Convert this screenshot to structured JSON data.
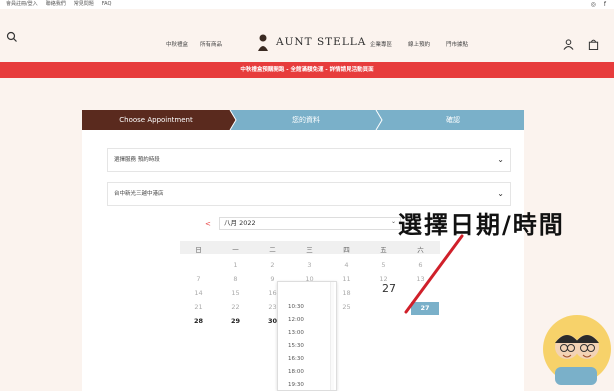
{
  "topbar": {
    "links": [
      "會員註冊/登入",
      "聯絡我們",
      "常見問題",
      "FAQ"
    ],
    "social_icons": [
      "instagram-icon",
      "facebook-icon"
    ]
  },
  "header": {
    "logo_text": "AUNT STELLA",
    "nav_left": [
      "中秋禮盒",
      "所有商品"
    ],
    "nav_right": [
      "企業專區",
      "線上預約",
      "門市據點"
    ],
    "icons": [
      "search-icon",
      "user-icon",
      "bag-icon"
    ]
  },
  "promo": {
    "text": "中秋禮盒預購開跑 - 全館滿額免運 - 詳情請見活動頁面"
  },
  "steps": {
    "items": [
      "Choose Appointment",
      "您的資料",
      "確認"
    ],
    "active_index": 0,
    "colors": {
      "active": "#5a2a1e",
      "inactive": "#7ab0c9",
      "text_inactive": "#ffffff"
    }
  },
  "accordion": [
    {
      "label": "選擇服務 預約時段"
    },
    {
      "label": "台中新光三越中港店"
    }
  ],
  "calendar": {
    "prev_label": "<",
    "month_label": "八月 2022",
    "weekdays": [
      "日",
      "一",
      "二",
      "三",
      "四",
      "五",
      "六"
    ],
    "weeks": [
      [
        "",
        "1",
        "2",
        "3",
        "4",
        "5",
        "6"
      ],
      [
        "7",
        "8",
        "9",
        "10",
        "11",
        "12",
        "13"
      ],
      [
        "14",
        "15",
        "16",
        "17",
        "18",
        "",
        ""
      ],
      [
        "21",
        "22",
        "23",
        "24",
        "25",
        "",
        "27"
      ],
      [
        "28",
        "29",
        "30",
        "31",
        "",
        "",
        ""
      ]
    ],
    "selected_day": "27",
    "time_options": [
      "10:30",
      "12:00",
      "13:00",
      "15:30",
      "16:30",
      "18:00",
      "19:30"
    ],
    "selected_time_preview": "27",
    "accent": "#7ab0c9"
  },
  "annotation": {
    "text": "選擇日期/時間",
    "color": "#111111",
    "arrow_color": "#d0202a"
  }
}
